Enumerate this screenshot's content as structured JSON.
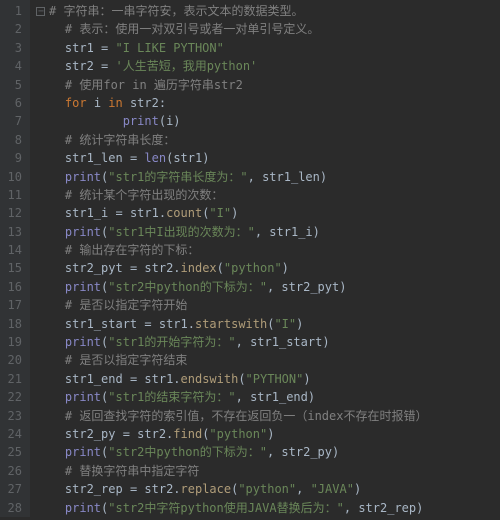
{
  "lines": [
    {
      "n": "1",
      "indent": 0,
      "tokens": [
        {
          "cls": "fold",
          "text": ""
        },
        {
          "cls": "c",
          "text": "# 字符串：一串字符安，表示文本的数据类型。"
        }
      ]
    },
    {
      "n": "2",
      "indent": 1,
      "tokens": [
        {
          "cls": "c",
          "text": "# 表示：使用一对双引号或者一对单引号定义。"
        }
      ]
    },
    {
      "n": "3",
      "indent": 1,
      "tokens": [
        {
          "cls": "id",
          "text": "str1 "
        },
        {
          "cls": "op",
          "text": "= "
        },
        {
          "cls": "s",
          "text": "\"I LIKE PYTHON\""
        }
      ]
    },
    {
      "n": "4",
      "indent": 1,
      "tokens": [
        {
          "cls": "id",
          "text": "str2 "
        },
        {
          "cls": "op",
          "text": "= "
        },
        {
          "cls": "s",
          "text": "'人生苦短，我用python'"
        }
      ]
    },
    {
      "n": "5",
      "indent": 1,
      "tokens": [
        {
          "cls": "c",
          "text": "# 使用for in 遍历字符串str2"
        }
      ]
    },
    {
      "n": "6",
      "indent": 1,
      "tokens": [
        {
          "cls": "kw",
          "text": "for "
        },
        {
          "cls": "id",
          "text": "i "
        },
        {
          "cls": "kw",
          "text": "in "
        },
        {
          "cls": "id",
          "text": "str2"
        },
        {
          "cls": "op",
          "text": ":"
        }
      ]
    },
    {
      "n": "7",
      "indent": 3,
      "tokens": [
        {
          "cls": "fn",
          "text": "print"
        },
        {
          "cls": "op",
          "text": "("
        },
        {
          "cls": "id",
          "text": "i"
        },
        {
          "cls": "op",
          "text": ")"
        }
      ]
    },
    {
      "n": "8",
      "indent": 1,
      "tokens": [
        {
          "cls": "c",
          "text": "# 统计字符串长度："
        }
      ]
    },
    {
      "n": "9",
      "indent": 1,
      "tokens": [
        {
          "cls": "id",
          "text": "str1_len "
        },
        {
          "cls": "op",
          "text": "= "
        },
        {
          "cls": "fn",
          "text": "len"
        },
        {
          "cls": "op",
          "text": "("
        },
        {
          "cls": "id",
          "text": "str1"
        },
        {
          "cls": "op",
          "text": ")"
        }
      ]
    },
    {
      "n": "10",
      "indent": 1,
      "tokens": [
        {
          "cls": "fn",
          "text": "print"
        },
        {
          "cls": "op",
          "text": "("
        },
        {
          "cls": "s",
          "text": "\"str1的字符串长度为：\""
        },
        {
          "cls": "op",
          "text": ", "
        },
        {
          "cls": "id",
          "text": "str1_len"
        },
        {
          "cls": "op",
          "text": ")"
        }
      ]
    },
    {
      "n": "11",
      "indent": 1,
      "tokens": [
        {
          "cls": "c",
          "text": "# 统计某个字符出现的次数："
        }
      ]
    },
    {
      "n": "12",
      "indent": 1,
      "tokens": [
        {
          "cls": "id",
          "text": "str1_i "
        },
        {
          "cls": "op",
          "text": "= "
        },
        {
          "cls": "id",
          "text": "str1."
        },
        {
          "cls": "m",
          "text": "count"
        },
        {
          "cls": "op",
          "text": "("
        },
        {
          "cls": "s",
          "text": "\"I\""
        },
        {
          "cls": "op",
          "text": ")"
        }
      ]
    },
    {
      "n": "13",
      "indent": 1,
      "tokens": [
        {
          "cls": "fn",
          "text": "print"
        },
        {
          "cls": "op",
          "text": "("
        },
        {
          "cls": "s",
          "text": "\"str1中I出现的次数为：\""
        },
        {
          "cls": "op",
          "text": ", "
        },
        {
          "cls": "id",
          "text": "str1_i"
        },
        {
          "cls": "op",
          "text": ")"
        }
      ]
    },
    {
      "n": "14",
      "indent": 1,
      "tokens": [
        {
          "cls": "c",
          "text": "# 输出存在字符的下标："
        }
      ]
    },
    {
      "n": "15",
      "indent": 1,
      "tokens": [
        {
          "cls": "id",
          "text": "str2_pyt "
        },
        {
          "cls": "op",
          "text": "= "
        },
        {
          "cls": "id",
          "text": "str2."
        },
        {
          "cls": "m",
          "text": "index"
        },
        {
          "cls": "op",
          "text": "("
        },
        {
          "cls": "s",
          "text": "\"python\""
        },
        {
          "cls": "op",
          "text": ")"
        }
      ]
    },
    {
      "n": "16",
      "indent": 1,
      "tokens": [
        {
          "cls": "fn",
          "text": "print"
        },
        {
          "cls": "op",
          "text": "("
        },
        {
          "cls": "s",
          "text": "\"str2中python的下标为：\""
        },
        {
          "cls": "op",
          "text": ", "
        },
        {
          "cls": "id",
          "text": "str2_pyt"
        },
        {
          "cls": "op",
          "text": ")"
        }
      ]
    },
    {
      "n": "17",
      "indent": 1,
      "tokens": [
        {
          "cls": "c",
          "text": "# 是否以指定字符开始"
        }
      ]
    },
    {
      "n": "18",
      "indent": 1,
      "tokens": [
        {
          "cls": "id",
          "text": "str1_start "
        },
        {
          "cls": "op",
          "text": "= "
        },
        {
          "cls": "id",
          "text": "str1."
        },
        {
          "cls": "m",
          "text": "startswith"
        },
        {
          "cls": "op",
          "text": "("
        },
        {
          "cls": "s",
          "text": "\"I\""
        },
        {
          "cls": "op",
          "text": ")"
        }
      ]
    },
    {
      "n": "19",
      "indent": 1,
      "tokens": [
        {
          "cls": "fn",
          "text": "print"
        },
        {
          "cls": "op",
          "text": "("
        },
        {
          "cls": "s",
          "text": "\"str1的开始字符为：\""
        },
        {
          "cls": "op",
          "text": ", "
        },
        {
          "cls": "id",
          "text": "str1_start"
        },
        {
          "cls": "op",
          "text": ")"
        }
      ]
    },
    {
      "n": "20",
      "indent": 1,
      "tokens": [
        {
          "cls": "c",
          "text": "# 是否以指定字符结束"
        }
      ]
    },
    {
      "n": "21",
      "indent": 1,
      "tokens": [
        {
          "cls": "id",
          "text": "str1_end "
        },
        {
          "cls": "op",
          "text": "= "
        },
        {
          "cls": "id",
          "text": "str1."
        },
        {
          "cls": "m",
          "text": "endswith"
        },
        {
          "cls": "op",
          "text": "("
        },
        {
          "cls": "s",
          "text": "\"PYTHON\""
        },
        {
          "cls": "op",
          "text": ")"
        }
      ]
    },
    {
      "n": "22",
      "indent": 1,
      "tokens": [
        {
          "cls": "fn",
          "text": "print"
        },
        {
          "cls": "op",
          "text": "("
        },
        {
          "cls": "s",
          "text": "\"str1的结束字符为：\""
        },
        {
          "cls": "op",
          "text": ", "
        },
        {
          "cls": "id",
          "text": "str1_end"
        },
        {
          "cls": "op",
          "text": ")"
        }
      ]
    },
    {
      "n": "23",
      "indent": 1,
      "tokens": [
        {
          "cls": "c",
          "text": "# 返回查找字符的索引值，不存在返回负一（index不存在时报错）"
        }
      ]
    },
    {
      "n": "24",
      "indent": 1,
      "tokens": [
        {
          "cls": "id",
          "text": "str2_py "
        },
        {
          "cls": "op",
          "text": "= "
        },
        {
          "cls": "id",
          "text": "str2."
        },
        {
          "cls": "m",
          "text": "find"
        },
        {
          "cls": "op",
          "text": "("
        },
        {
          "cls": "s",
          "text": "\"python\""
        },
        {
          "cls": "op",
          "text": ")"
        }
      ]
    },
    {
      "n": "25",
      "indent": 1,
      "tokens": [
        {
          "cls": "fn",
          "text": "print"
        },
        {
          "cls": "op",
          "text": "("
        },
        {
          "cls": "s",
          "text": "\"str2中python的下标为：\""
        },
        {
          "cls": "op",
          "text": ", "
        },
        {
          "cls": "id",
          "text": "str2_py"
        },
        {
          "cls": "op",
          "text": ")"
        }
      ]
    },
    {
      "n": "26",
      "indent": 1,
      "tokens": [
        {
          "cls": "c",
          "text": "# 替换字符串中指定字符"
        }
      ]
    },
    {
      "n": "27",
      "indent": 1,
      "tokens": [
        {
          "cls": "id",
          "text": "str2_rep "
        },
        {
          "cls": "op",
          "text": "= "
        },
        {
          "cls": "id",
          "text": "str2."
        },
        {
          "cls": "m",
          "text": "replace"
        },
        {
          "cls": "op",
          "text": "("
        },
        {
          "cls": "s",
          "text": "\"python\""
        },
        {
          "cls": "op",
          "text": ", "
        },
        {
          "cls": "s",
          "text": "\"JAVA\""
        },
        {
          "cls": "op",
          "text": ")"
        }
      ]
    },
    {
      "n": "28",
      "indent": 1,
      "tokens": [
        {
          "cls": "fn",
          "text": "print"
        },
        {
          "cls": "op",
          "text": "("
        },
        {
          "cls": "s",
          "text": "\"str2中字符python使用JAVA替换后为：\""
        },
        {
          "cls": "op",
          "text": ", "
        },
        {
          "cls": "id",
          "text": "str2_rep"
        },
        {
          "cls": "op",
          "text": ")"
        }
      ]
    }
  ]
}
